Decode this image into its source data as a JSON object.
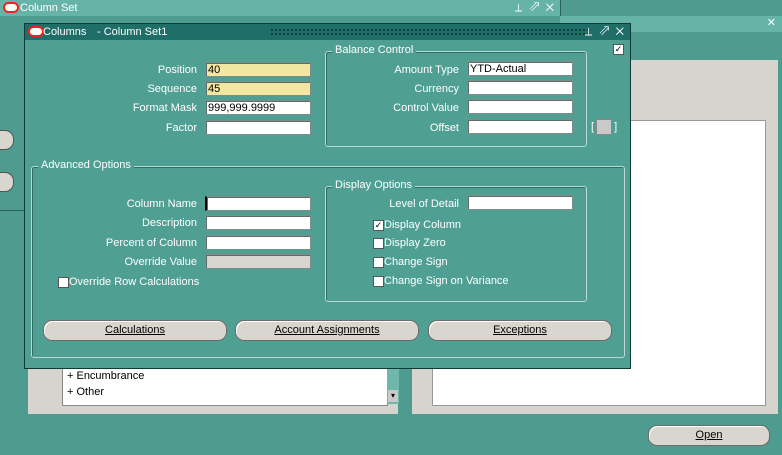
{
  "back_window": {
    "title": "Column Set",
    "controls": "⟂ ⇗ ✕"
  },
  "right_window": {
    "controls": "✕"
  },
  "columns_window": {
    "title_app": "Columns",
    "title_doc": "- Column Set1",
    "controls": "⟂ ⇗ ✕",
    "position_label": "Position",
    "position_value": "40",
    "sequence_label": "Sequence",
    "sequence_value": "45",
    "format_mask_label": "Format Mask",
    "format_mask_value": "999,999.9999",
    "factor_label": "Factor",
    "factor_value": "",
    "balance_control": {
      "legend": "Balance Control",
      "amount_type_label": "Amount Type",
      "amount_type_value": "YTD-Actual",
      "currency_label": "Currency",
      "currency_value": "",
      "control_value_label": "Control Value",
      "control_value_value": "",
      "offset_label": "Offset",
      "offset_value": ""
    },
    "advanced": {
      "legend": "Advanced Options",
      "column_name_label": "Column Name",
      "column_name_value": "",
      "description_label": "Description",
      "description_value": "",
      "percent_label": "Percent of Column",
      "percent_value": "",
      "override_value_label": "Override Value",
      "override_value_value": "",
      "override_row_calc_label": "Override Row Calculations",
      "override_row_calc_checked": false
    },
    "display_options": {
      "legend": "Display Options",
      "level_of_detail_label": "Level of Detail",
      "level_of_detail_value": "",
      "display_column_label": "Display Column",
      "display_column_checked": true,
      "display_zero_label": "Display Zero",
      "display_zero_checked": false,
      "change_sign_label": "Change Sign",
      "change_sign_checked": false,
      "change_sign_variance_label": "Change Sign on Variance",
      "change_sign_variance_checked": false
    },
    "buttons": {
      "calculations": "Calculations",
      "account_assignments": "Account Assignments",
      "exceptions": "Exceptions"
    }
  },
  "tree": {
    "items": [
      "+ Encumbrance",
      "+ Other"
    ]
  },
  "open_button": "Open",
  "colors": {
    "bg": "#4e9b8f",
    "titlebar_active": "#1f6f68",
    "required": "#f3e6a0"
  }
}
